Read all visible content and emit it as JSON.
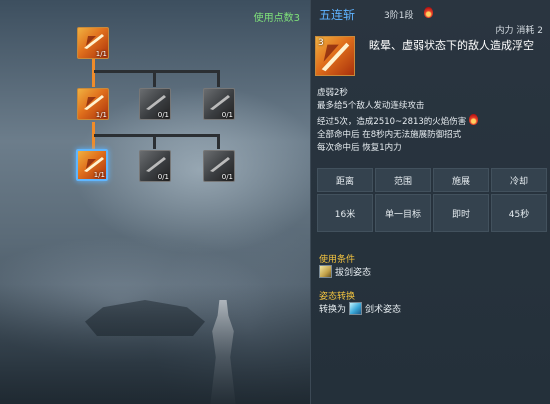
{
  "tree": {
    "points_used": "使用点数3",
    "nodes": [
      {
        "id": "n1",
        "level": "1/1",
        "state": "active"
      },
      {
        "id": "n2",
        "level": "1/1",
        "state": "active"
      },
      {
        "id": "n3",
        "level": "0/1",
        "state": "inactive"
      },
      {
        "id": "n4",
        "level": "0/1",
        "state": "inactive"
      },
      {
        "id": "n5",
        "level": "1/1",
        "state": "selected"
      },
      {
        "id": "n6",
        "level": "0/1",
        "state": "inactive"
      },
      {
        "id": "n7",
        "level": "0/1",
        "state": "inactive"
      }
    ]
  },
  "skill": {
    "name": "五连斩",
    "tier": "3阶1段",
    "cost": "内力 消耗 2",
    "icon_number": "3",
    "effect": "眩晕、虚弱状态下的敌人造成浮空",
    "desc": [
      "虚弱2秒",
      "最多给5个敌人发动连续攻击",
      "经过5次，造成2510~2813的火焰伤害",
      "全部命中后 在8秒内无法施展防御招式",
      "每次命中后 恢复1内力"
    ],
    "stats_headers": [
      "距离",
      "范围",
      "施展",
      "冷却"
    ],
    "stats_values": [
      "16米",
      "单一目标",
      "即时",
      "45秒"
    ],
    "use_condition_title": "使用条件",
    "use_condition": "拔剑姿态",
    "stance_title": "姿态转换",
    "stance_prefix": "转换为",
    "stance": "剑术姿态"
  },
  "colors": {
    "accent_blue": "#5fb3ff",
    "points_green": "#7fe07a",
    "section_yellow": "#f3c440",
    "active_orange": "#e0701c"
  }
}
